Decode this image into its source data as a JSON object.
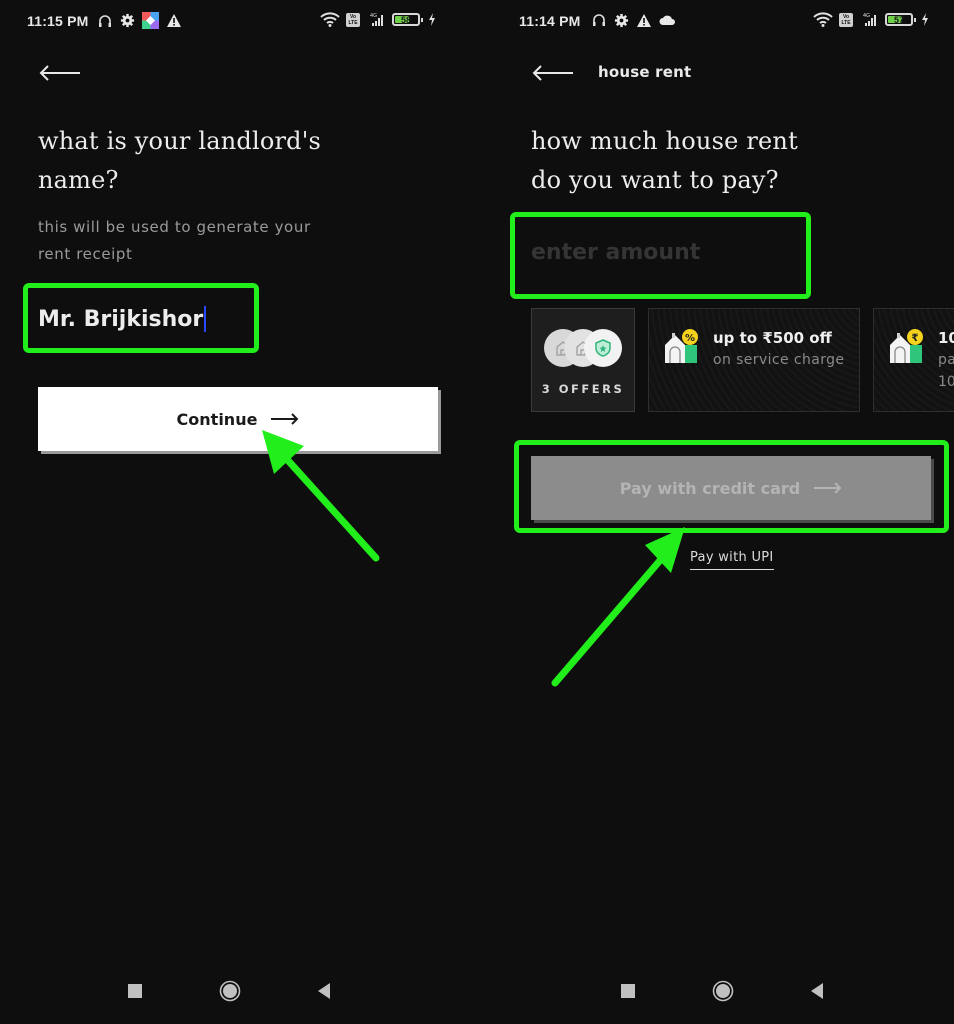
{
  "left_screen": {
    "status_bar": {
      "time": "11:15 PM",
      "left_icons": [
        "headset-icon",
        "settings-gear-icon",
        "app-colorful-icon",
        "warning-icon"
      ],
      "right_icons": [
        "wifi-icon",
        "volte-icon",
        "signal-4g-icon",
        "battery-icon",
        "charging-icon"
      ],
      "battery_level": "58",
      "volte_label": "Vo LTE",
      "network_label": "4G"
    },
    "question": "what is your landlord's name?",
    "question_line1": "what is your landlord's",
    "question_line2": "name?",
    "helper_line1": "this will be used to generate your",
    "helper_line2": "rent receipt",
    "name_value": "Mr. Brijkishor",
    "continue_label": "Continue"
  },
  "right_screen": {
    "status_bar": {
      "time": "11:14 PM",
      "left_icons": [
        "headset-icon",
        "settings-gear-icon",
        "warning-icon",
        "cloud-icon"
      ],
      "right_icons": [
        "wifi-icon",
        "volte-icon",
        "signal-4g-icon",
        "battery-icon",
        "charging-icon"
      ],
      "battery_level": "57",
      "volte_label": "Vo LTE",
      "network_label": "4G"
    },
    "page_title": "house rent",
    "question_line1": "how much house rent",
    "question_line2": "do you want to pay?",
    "amount_placeholder": "enter amount",
    "amount_value": "",
    "offers_count_label": "3 OFFERS",
    "offers": [
      {
        "title": "up to ₹500 off",
        "subtitle": "on service charge",
        "badge": "%",
        "badge_icon": "percent-badge-icon"
      },
      {
        "title": "10",
        "subtitle": "pa",
        "extra": "10",
        "badge": "₹",
        "badge_icon": "rupee-badge-icon"
      }
    ],
    "pay_credit_label": "Pay with credit card",
    "pay_upi_label": "Pay with UPI"
  },
  "nav_bar": {
    "buttons": [
      "recents-square-icon",
      "home-circle-icon",
      "back-triangle-icon"
    ]
  },
  "colors": {
    "background": "#0e0e0e",
    "annotation_green": "#22ee1c",
    "primary_button": "#ffffff",
    "disabled_button": "#8c8c8c",
    "offer_badge_yellow": "#f5d21c",
    "house_green": "#2fc57a",
    "battery_green": "#6fd04a"
  }
}
